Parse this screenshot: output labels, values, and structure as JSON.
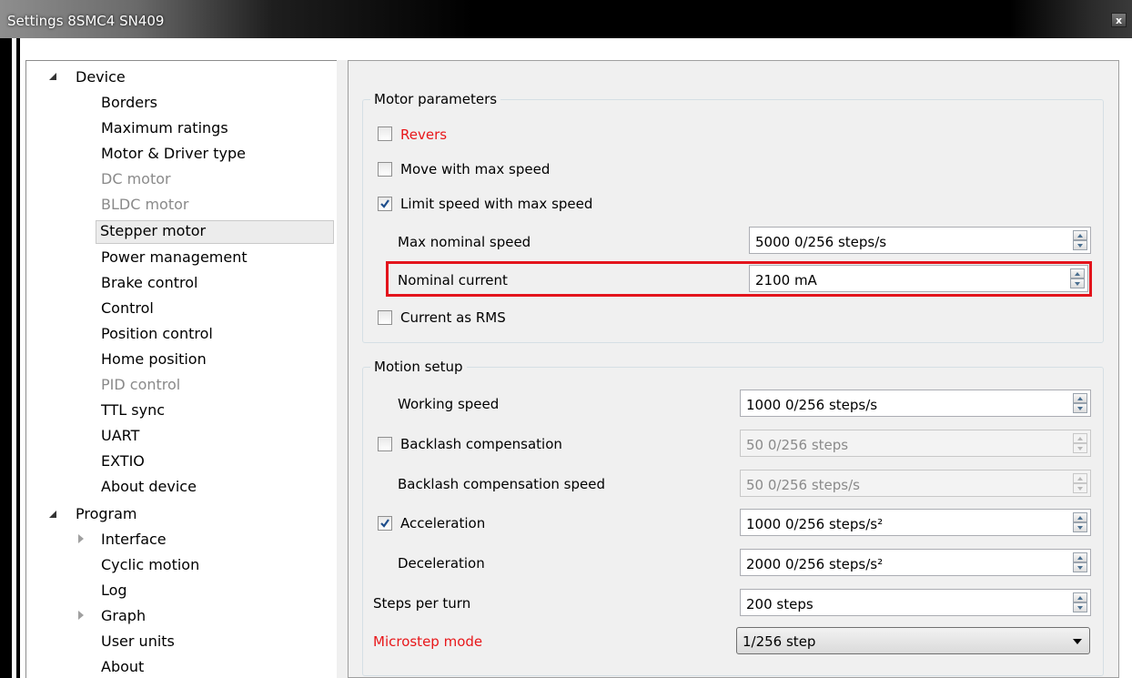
{
  "window": {
    "title": "Settings 8SMC4 SN409",
    "close_label": "x"
  },
  "tree": {
    "device": {
      "label": "Device",
      "items": [
        {
          "label": "Borders",
          "enabled": true
        },
        {
          "label": "Maximum ratings",
          "enabled": true
        },
        {
          "label": "Motor & Driver type",
          "enabled": true
        },
        {
          "label": "DC motor",
          "enabled": false
        },
        {
          "label": "BLDC motor",
          "enabled": false
        },
        {
          "label": "Stepper motor",
          "enabled": true,
          "selected": true
        },
        {
          "label": "Power management",
          "enabled": true
        },
        {
          "label": "Brake control",
          "enabled": true
        },
        {
          "label": "Control",
          "enabled": true
        },
        {
          "label": "Position control",
          "enabled": true
        },
        {
          "label": "Home position",
          "enabled": true
        },
        {
          "label": "PID control",
          "enabled": false
        },
        {
          "label": "TTL sync",
          "enabled": true
        },
        {
          "label": "UART",
          "enabled": true
        },
        {
          "label": "EXTIO",
          "enabled": true
        },
        {
          "label": "About device",
          "enabled": true
        }
      ]
    },
    "program": {
      "label": "Program",
      "items": [
        {
          "label": "Interface",
          "expandable": true
        },
        {
          "label": "Cyclic motion"
        },
        {
          "label": "Log"
        },
        {
          "label": "Graph",
          "expandable": true
        },
        {
          "label": "User units"
        },
        {
          "label": "About"
        }
      ]
    }
  },
  "motor_parameters": {
    "title": "Motor parameters",
    "revers": {
      "label": "Revers",
      "checked": false
    },
    "move_max_speed": {
      "label": "Move with max speed",
      "checked": false
    },
    "limit_speed": {
      "label": "Limit speed with max speed",
      "checked": true
    },
    "max_nominal_speed": {
      "label": "Max nominal speed",
      "value": "5000 0/256 steps/s"
    },
    "nominal_current": {
      "label": "Nominal current",
      "value": "2100 mA"
    },
    "current_rms": {
      "label": "Current as RMS",
      "checked": false
    }
  },
  "motion_setup": {
    "title": "Motion setup",
    "working_speed": {
      "label": "Working speed",
      "value": "1000 0/256 steps/s"
    },
    "backlash": {
      "label": "Backlash compensation",
      "checked": false,
      "value": "50 0/256 steps"
    },
    "backlash_speed": {
      "label": "Backlash compensation speed",
      "value": "50 0/256 steps/s"
    },
    "acceleration": {
      "label": "Acceleration",
      "checked": true,
      "value": "1000 0/256 steps/s²"
    },
    "deceleration": {
      "label": "Deceleration",
      "value": "2000 0/256 steps/s²"
    },
    "steps_per_turn": {
      "label": "Steps per turn",
      "value": "200 steps"
    },
    "microstep_mode": {
      "label": "Microstep mode",
      "value": "1/256 step"
    }
  },
  "colors": {
    "warning_red": "#e8171a",
    "highlight_red": "#e3141c",
    "panel_bg": "#f0f0f0"
  }
}
